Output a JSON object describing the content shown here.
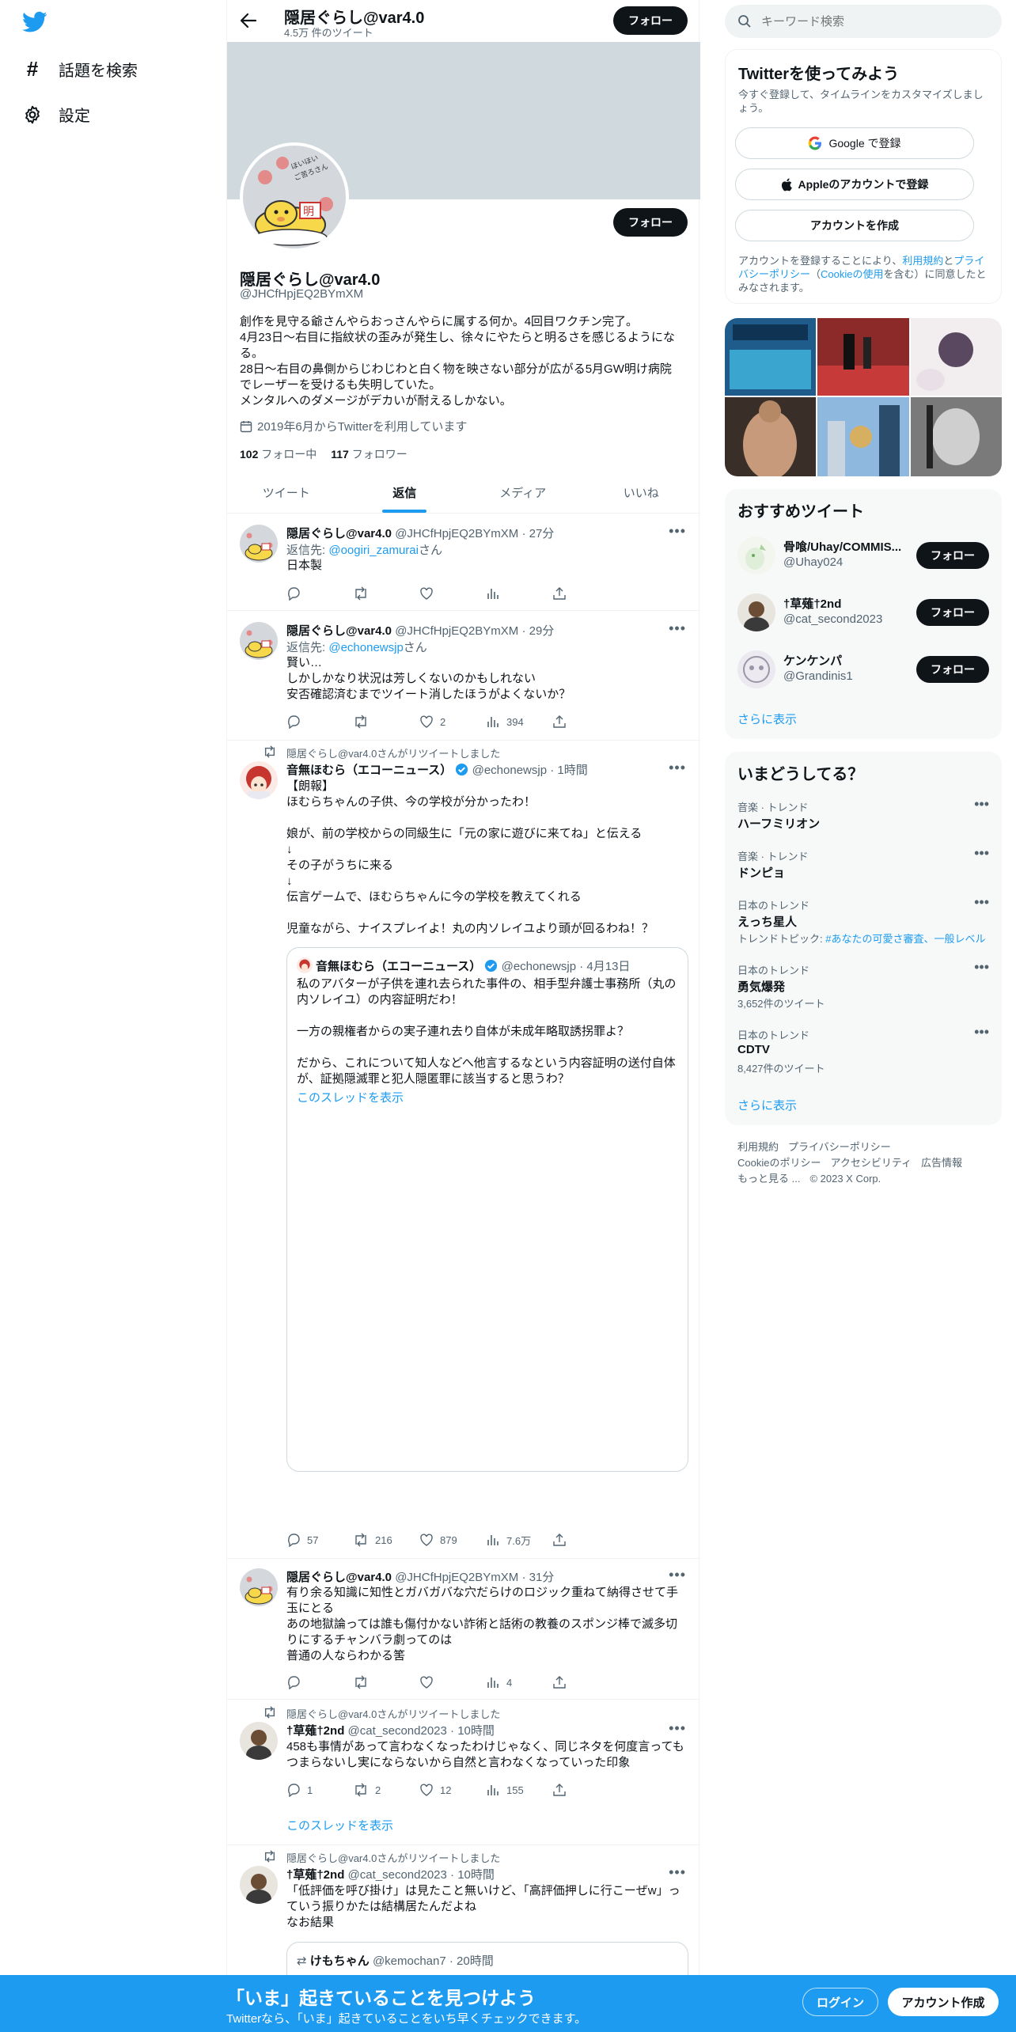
{
  "nav": {
    "explore_label": "話題を検索",
    "settings_label": "設定"
  },
  "profile": {
    "header_name": "隠居ぐらし@var4.0",
    "tweet_count": "4.5万 件のツイート",
    "follow_label": "フォロー",
    "name": "隠居ぐらし@var4.0",
    "handle": "@JHCfHpjEQ2BYmXM",
    "bio": "創作を見守る爺さんやらおっさんやらに属する何か。4回目ワクチン完了。\n4月23日〜右目に指紋状の歪みが発生し、徐々にやたらと明るさを感じるようになる。\n28日〜右目の鼻側からじわじわと白く物を映さない部分が広がる5月GW明け病院でレーザーを受けるも失明していた。\nメンタルへのダメージがデカいが耐えるしかない。",
    "joined": "2019年6月からTwitterを利用しています",
    "following_count": "102",
    "following_label": "フォロー中",
    "followers_count": "117",
    "followers_label": "フォロワー",
    "avatar_text": "ほいほいっ ご苦ろさん おやまぁ"
  },
  "tabs": [
    "ツイート",
    "返信",
    "メディア",
    "いいね"
  ],
  "tweets": [
    {
      "name": "隠居ぐらし@var4.0",
      "handle": "@JHCfHpjEQ2BYmXM",
      "time": "· 27分",
      "reply_prefix": "返信先: ",
      "reply_to": "@oogiri_zamurai",
      "reply_suffix": "さん",
      "text": "日本製",
      "stats": [
        "",
        "",
        "",
        ""
      ]
    },
    {
      "name": "隠居ぐらし@var4.0",
      "handle": "@JHCfHpjEQ2BYmXM",
      "time": "· 29分",
      "reply_prefix": "返信先: ",
      "reply_to": "@echonewsjp",
      "reply_suffix": "さん",
      "text": "賢い…\nしかしかなり状況は芳しくないのかもしれない\n安否確認済むまでツイート消したほうがよくないか？",
      "stats": [
        "",
        "",
        "2",
        "394"
      ]
    },
    {
      "retweet_label": "隠居ぐらし@var4.0さんがリツイートしました",
      "name": "音無ほむら（エコーニュース）",
      "handle": "@echonewsjp",
      "time": "· 1時間",
      "text": "【朗報】\nほむらちゃんの子供、今の学校が分かったわ！\n\n娘が、前の学校からの同級生に「元の家に遊びに来てね」と伝える\n↓\nその子がうちに来る\n↓\n伝言ゲームで、ほむらちゃんに今の学校を教えてくれる\n\n児童ながら、ナイスプレイよ！丸の内ソレイユより頭が回るわね！？",
      "quote": {
        "name": "音無ほむら（エコーニュース）",
        "handle": "@echonewsjp",
        "time": "· 4月13日",
        "text": "私のアバターが子供を連れ去られた事件の、相手型弁護士事務所（丸の内ソレイユ）の内容証明だわ！\n\n一方の親権者からの実子連れ去り自体が未成年略取誘拐罪よ？\n\nだから、これについて知人などへ他言するなという内容証明の送付自体が、証拠隠滅罪と犯人隠匿罪に該当すると思うわ？",
        "show_thread": "このスレッドを表示"
      },
      "stats": [
        "57",
        "216",
        "879",
        "7.6万"
      ]
    },
    {
      "name": "隠居ぐらし@var4.0",
      "handle": "@JHCfHpjEQ2BYmXM",
      "time": "· 31分",
      "text": "有り余る知識に知性とガバガバな穴だらけのロジック重ねて納得させて手玉にとる\nあの地獄論っては誰も傷付かない詐術と話術の教養のスポンジ棒で滅多切りにするチャンバラ劇ってのは\n普通の人ならわかる筈",
      "stats": [
        "",
        "",
        "",
        "4"
      ]
    },
    {
      "retweet_label": "隠居ぐらし@var4.0さんがリツイートしました",
      "name": "†草薙†2nd",
      "handle": "@cat_second2023",
      "time": "· 10時間",
      "text": "458も事情があって言わなくなったわけじゃなく、同じネタを何度言ってもつまらないし実にならないから自然と言わなくなっていった印象",
      "stats": [
        "1",
        "2",
        "12",
        "155"
      ],
      "show_thread": "このスレッドを表示"
    },
    {
      "retweet_label": "隠居ぐらし@var4.0さんがリツイートしました",
      "name": "†草薙†2nd",
      "handle": "@cat_second2023",
      "time": "· 10時間",
      "text": "「低評価を呼び掛け」は見たこと無いけど、「高評価押しに行こーぜw」っていう振りかたは結構居たんだよね\nなお結果",
      "quote": {
        "name": "けもちゃん",
        "handle": "@kemochan7",
        "time": "· 20時間"
      }
    }
  ],
  "search": {
    "placeholder": "キーワード検索"
  },
  "signup": {
    "title": "Twitterを使ってみよう",
    "subtitle": "今すぐ登録して、タイムラインをカスタマイズしましょう。",
    "google_label": "Google で登録",
    "apple_label": "Appleのアカウントで登録",
    "create_label": "アカウントを作成",
    "legal_prefix": "アカウントを登録することにより、",
    "legal_terms": "利用規約",
    "legal_and": "と",
    "legal_privacy": "プライバシーポリシー",
    "legal_paren_open": "（",
    "legal_cookie": "Cookieの使用",
    "legal_suffix": "を含む）に同意したとみなされます。"
  },
  "suggested": {
    "title": "おすすめツイート",
    "users": [
      {
        "name": "骨喰/Uhay/COMMIS...",
        "handle": "@Uhay024",
        "follow": "フォロー"
      },
      {
        "name": "†草薙†2nd",
        "handle": "@cat_second2023",
        "follow": "フォロー"
      },
      {
        "name": "ケンケンパ",
        "handle": "@Grandinis1",
        "follow": "フォロー"
      }
    ],
    "more": "さらに表示"
  },
  "trends": {
    "title": "いまどうしてる？",
    "items": [
      {
        "category": "音楽 · トレンド",
        "name": "ハーフミリオン",
        "sub": ""
      },
      {
        "category": "音楽 · トレンド",
        "name": "ドンピョ",
        "sub": ""
      },
      {
        "category": "日本のトレンド",
        "name": "えっち星人",
        "sub_prefix": "トレンドトピック: ",
        "sub_link": "#あなたの可愛さ審査、一般レベル"
      },
      {
        "category": "日本のトレンド",
        "name": "勇気爆発",
        "sub": "3,652件のツイート"
      },
      {
        "category": "日本のトレンド",
        "name": "CDTV",
        "sub": "8,427件のツイート"
      }
    ],
    "more": "さらに表示"
  },
  "footer": {
    "terms": "利用規約",
    "privacy": "プライバシーポリシー",
    "cookie": "Cookieのポリシー",
    "accessibility": "アクセシビリティ",
    "ads": "広告情報",
    "more": "もっと見る ...",
    "copyright": "© 2023 X Corp."
  },
  "banner": {
    "title": "「いま」起きていることを見つけよう",
    "subtitle": "Twitterなら、「いま」起きていることをいち早くチェックできます。",
    "login": "ログイン",
    "signup": "アカウント作成"
  },
  "colors": {
    "accent": "#1d9bf0",
    "text": "#0f1419",
    "muted": "#536471"
  }
}
